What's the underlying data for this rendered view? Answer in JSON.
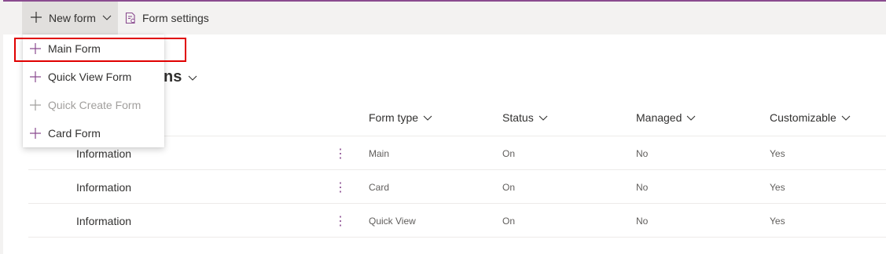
{
  "toolbar": {
    "new_form_label": "New form",
    "form_settings_label": "Form settings"
  },
  "page": {
    "title": "ns"
  },
  "dropdown": {
    "items": [
      {
        "label": "Main Form",
        "icon": "plus-icon",
        "disabled": false,
        "highlighted": true
      },
      {
        "label": "Quick View Form",
        "icon": "plus-icon",
        "disabled": false
      },
      {
        "label": "Quick Create Form",
        "icon": "plus-icon",
        "disabled": true
      },
      {
        "label": "Card Form",
        "icon": "plus-icon",
        "disabled": false
      }
    ]
  },
  "table": {
    "columns": [
      {
        "label": "Form type"
      },
      {
        "label": "Status"
      },
      {
        "label": "Managed"
      },
      {
        "label": "Customizable"
      }
    ],
    "rows": [
      {
        "name": "Information",
        "more": "⋮",
        "type": "Main",
        "status": "On",
        "managed": "No",
        "customizable": "Yes"
      },
      {
        "name": "Information",
        "more": "⋮",
        "type": "Card",
        "status": "On",
        "managed": "No",
        "customizable": "Yes"
      },
      {
        "name": "Information",
        "more": "⋮",
        "type": "Quick View",
        "status": "On",
        "managed": "No",
        "customizable": "Yes"
      }
    ]
  },
  "colors": {
    "accent": "#8a4b8f",
    "highlight": "#e00000",
    "toolbar_bg": "#f3f2f1"
  }
}
